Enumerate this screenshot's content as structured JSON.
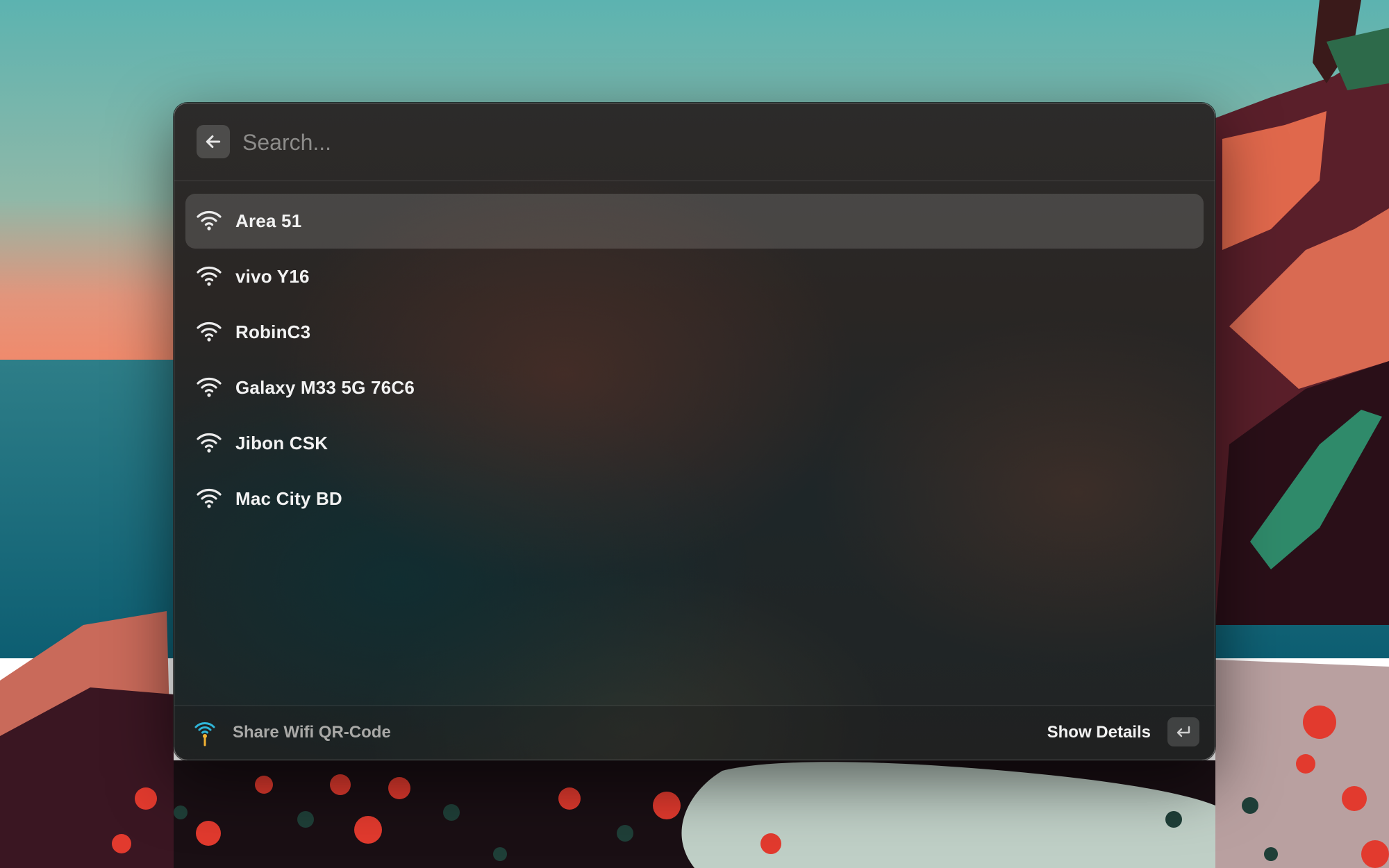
{
  "search": {
    "placeholder": "Search...",
    "back_icon": "arrow-left-icon"
  },
  "networks": [
    {
      "name": "Area 51",
      "icon": "wifi-icon",
      "selected": true
    },
    {
      "name": "vivo Y16",
      "icon": "wifi-icon",
      "selected": false
    },
    {
      "name": "RobinC3",
      "icon": "wifi-icon",
      "selected": false
    },
    {
      "name": "Galaxy M33 5G 76C6",
      "icon": "wifi-icon",
      "selected": false
    },
    {
      "name": "Jibon CSK",
      "icon": "wifi-icon",
      "selected": false
    },
    {
      "name": "Mac City BD",
      "icon": "wifi-icon",
      "selected": false
    }
  ],
  "footer": {
    "extension_name": "Share Wifi QR-Code",
    "extension_icon": "wifi-tower-icon",
    "primary_action": "Show Details",
    "primary_action_key": "return-key-icon"
  },
  "colors": {
    "window_bg": "#2a2827",
    "selected_row": "#4a4643",
    "text_primary": "#f2f2f2",
    "text_secondary": "#a9a9a7",
    "placeholder": "#8d8c8a"
  }
}
